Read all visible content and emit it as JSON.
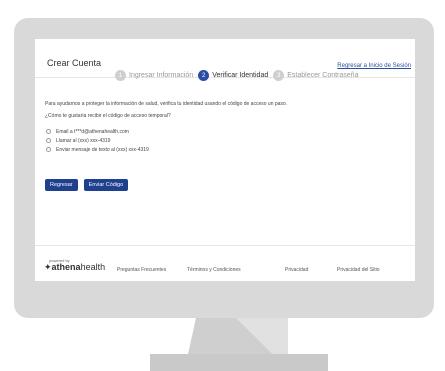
{
  "top_link": "Regresar a Inicio de Sesión",
  "page_title": "Crear Cuenta",
  "steps": [
    {
      "num": "1",
      "label": "Ingresar Información"
    },
    {
      "num": "2",
      "label": "Verificar Identidad"
    },
    {
      "num": "3",
      "label": "Establecer Contraseña"
    }
  ],
  "message": "Para ayudarnos a proteger la información de salud, verifica tu identidad usando el código de acceso un paso.",
  "question": "¿Cómo te gustaría recibir el código de acceso temporal?",
  "options": [
    "Email a t***d@athenahealth.com",
    "Llamar al (xxx) xxx-4319",
    "Enviar mensaje de texto al (xxx) xxx-4319"
  ],
  "buttons": {
    "back": "Regresar",
    "send": "Enviar Código"
  },
  "footer": {
    "powered_by": "powered by",
    "logo_a": "athena",
    "logo_b": "health",
    "links": [
      "Preguntas Frecuentes",
      "Términos y Condiciones",
      "Privacidad",
      "Privacidad del Sitio"
    ]
  },
  "colors": {
    "accent": "#2d4da2",
    "bezel": "#d9d9d9"
  }
}
